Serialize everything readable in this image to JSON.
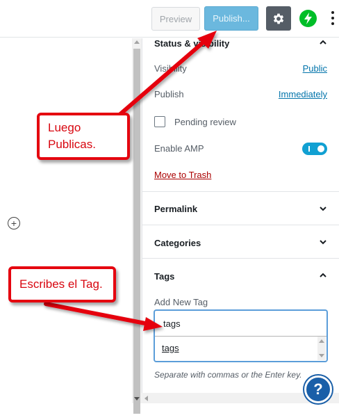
{
  "toolbar": {
    "preview_label": "Preview",
    "publish_label": "Publish...",
    "settings_icon": "gear-icon",
    "jetpack_icon": "jetpack-bolt-icon",
    "more_icon": "more-vertical-icon"
  },
  "editor": {
    "add_block_icon": "plus-circle-icon"
  },
  "sidebar": {
    "status_panel": {
      "title": "Status & visibility",
      "visibility_label": "Visibility",
      "visibility_value": "Public",
      "publish_label": "Publish",
      "publish_value": "Immediately",
      "pending_review_label": "Pending review",
      "pending_review_checked": false,
      "enable_amp_label": "Enable AMP",
      "enable_amp_on": true,
      "move_to_trash_label": "Move to Trash"
    },
    "permalink_panel": {
      "title": "Permalink"
    },
    "categories_panel": {
      "title": "Categories"
    },
    "tags_panel": {
      "title": "Tags",
      "add_new_label": "Add New Tag",
      "input_value": "tags",
      "suggestion": "tags",
      "hint": "Separate with commas or the Enter key."
    }
  },
  "help_label": "?",
  "annotations": {
    "callout_1": "Luego Publicas.",
    "callout_2": "Escribes el Tag."
  },
  "colors": {
    "publish_button": "#6bb8de",
    "settings_button": "#555d66",
    "jetpack": "#00be28",
    "link": "#0073aa",
    "trash": "#aa0000",
    "annotation_red": "#e5040f",
    "help_button": "#1a5fa8"
  }
}
